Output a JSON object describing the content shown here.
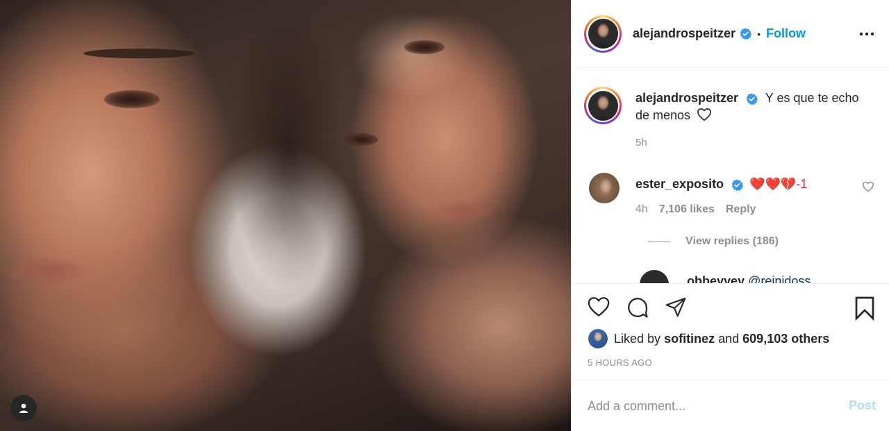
{
  "post": {
    "author": {
      "username": "alejandrospeitzer",
      "verified": true,
      "follow_label": "Follow",
      "separator": "•"
    },
    "caption": {
      "text": "Y es que te echo de menos",
      "emoji": "white-heart",
      "time_ago": "5h"
    },
    "comments": [
      {
        "username": "ester_exposito",
        "verified": true,
        "text": "❤️❤️💔-1",
        "time_ago": "4h",
        "likes": "7,106 likes",
        "reply_label": "Reply",
        "view_replies": "View replies (186)"
      }
    ],
    "partial_reply": {
      "username": "obbeyyey",
      "mention": "@reinidoss"
    },
    "likes": {
      "prefix": "Liked by",
      "first_user": "sofitinez",
      "and": "and",
      "others": "609,103 others"
    },
    "timestamp": "5 HOURS AGO",
    "add_comment": {
      "placeholder": "Add a comment...",
      "post_label": "Post"
    }
  },
  "icons": [
    "more-options-icon",
    "verified-badge-icon",
    "heart-icon",
    "comment-icon",
    "share-icon",
    "bookmark-icon",
    "user-tag-icon",
    "small-heart-icon"
  ],
  "colors": {
    "link_blue": "#0095f6",
    "verified_blue": "#3897f0",
    "text_primary": "#262626",
    "text_secondary": "#8e8e8e",
    "post_disabled": "#b3dbff",
    "heart_red": "#ed1c24"
  }
}
